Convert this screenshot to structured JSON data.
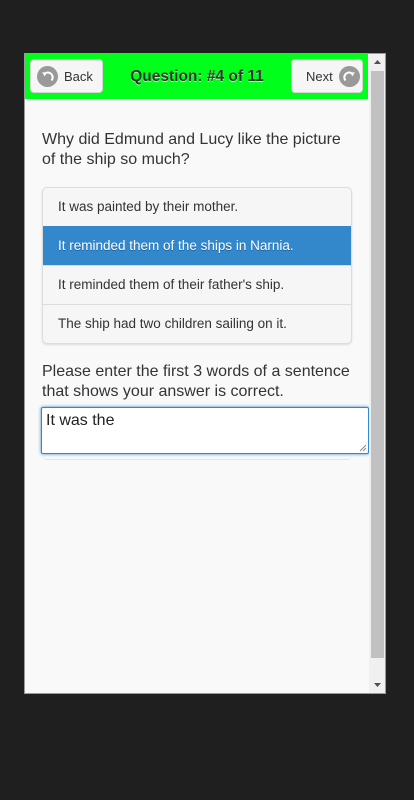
{
  "header": {
    "back_label": "Back",
    "title": "Question: #4 of 11",
    "next_label": "Next",
    "bar_color": "#00ff1a"
  },
  "question": {
    "text": "Why did Edmund and Lucy like the picture of the ship so much?",
    "choices": [
      "It was painted by their mother.",
      "It reminded them of the ships in Narnia.",
      "It reminded them of their father's ship.",
      "The ship had two children sailing on it."
    ],
    "selected_index": 1
  },
  "answer": {
    "prompt": "Please enter the first 3 words of a sentence that shows your answer is correct.",
    "value": "It was the"
  },
  "colors": {
    "selected_choice": "#3388cc",
    "page_background": "#f9f9f9",
    "frame": "#1f1f1f"
  },
  "icons": {
    "back": "back-arrow-circle-icon",
    "next": "redo-arrow-circle-icon",
    "scroll_up": "scroll-up-arrow-icon",
    "scroll_down": "scroll-down-arrow-icon"
  }
}
